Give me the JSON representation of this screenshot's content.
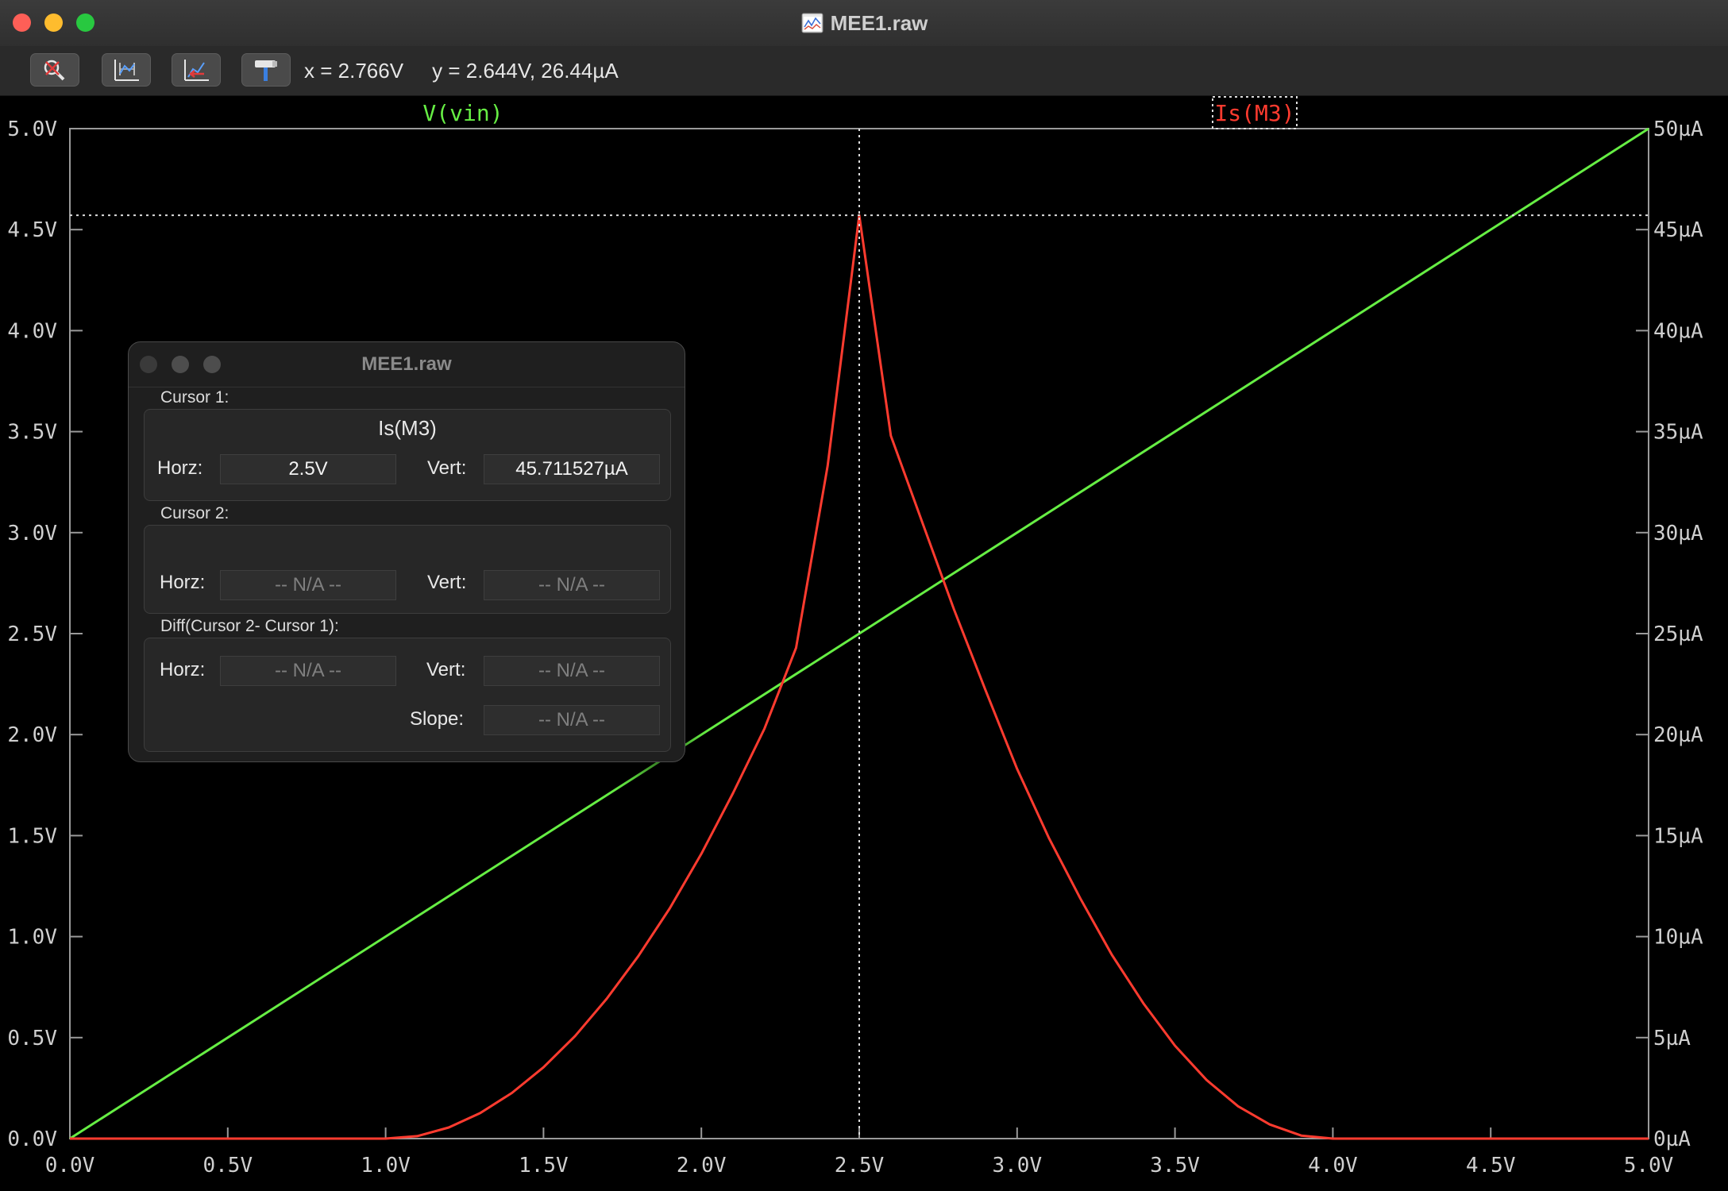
{
  "window": {
    "title": "MEE1.raw"
  },
  "toolbar": {
    "buttons": [
      {
        "name": "zoom-tool-icon"
      },
      {
        "name": "autorange-icon"
      },
      {
        "name": "zoom-back-icon"
      },
      {
        "name": "hammer-icon"
      }
    ],
    "x_readout": "x = 2.766V",
    "y_readout": "y = 2.644V, 26.44µA"
  },
  "chart_data": {
    "type": "line",
    "x_ticks": [
      "0.0V",
      "0.5V",
      "1.0V",
      "1.5V",
      "2.0V",
      "2.5V",
      "3.0V",
      "3.5V",
      "4.0V",
      "4.5V",
      "5.0V"
    ],
    "y_left_ticks": [
      "0.0V",
      "0.5V",
      "1.0V",
      "1.5V",
      "2.0V",
      "2.5V",
      "3.0V",
      "3.5V",
      "4.0V",
      "4.5V",
      "5.0V"
    ],
    "y_right_ticks": [
      "0µA",
      "5µA",
      "10µA",
      "15µA",
      "20µA",
      "25µA",
      "30µA",
      "35µA",
      "40µA",
      "45µA",
      "50µA"
    ],
    "xlim": [
      0,
      5
    ],
    "ylim_left": [
      0,
      5
    ],
    "ylim_right": [
      0,
      50
    ],
    "cursor": {
      "x": 2.5,
      "y_right": 45.711527
    },
    "series": [
      {
        "name": "V(vin)",
        "color": "#66ee44",
        "axis": "left",
        "x": [
          0,
          5
        ],
        "y": [
          0,
          5
        ]
      },
      {
        "name": "Is(M3)",
        "color": "#ff3b2f",
        "axis": "right",
        "x": [
          0,
          0.5,
          1.0,
          1.1,
          1.2,
          1.3,
          1.4,
          1.5,
          1.6,
          1.7,
          1.8,
          1.9,
          2.0,
          2.1,
          2.2,
          2.3,
          2.4,
          2.5,
          2.6,
          2.7,
          2.8,
          2.9,
          3.0,
          3.1,
          3.2,
          3.3,
          3.4,
          3.5,
          3.6,
          3.7,
          3.8,
          3.9,
          4.0,
          4.5,
          5.0
        ],
        "y": [
          0,
          0,
          0,
          0.12,
          0.55,
          1.27,
          2.26,
          3.53,
          5.08,
          6.92,
          9.03,
          11.4,
          14.1,
          17.1,
          20.3,
          24.3,
          33.3,
          45.71,
          34.8,
          30.5,
          26.2,
          22.2,
          18.3,
          14.9,
          11.9,
          9.1,
          6.7,
          4.6,
          2.9,
          1.6,
          0.7,
          0.15,
          0,
          0,
          0
        ]
      }
    ]
  },
  "cursor_panel": {
    "title": "MEE1.raw",
    "cursor1": {
      "label": "Cursor 1:",
      "trace": "Is(M3)",
      "horz_label": "Horz:",
      "horz": "2.5V",
      "vert_label": "Vert:",
      "vert": "45.711527µA"
    },
    "cursor2": {
      "label": "Cursor 2:",
      "horz_label": "Horz:",
      "horz": "-- N/A --",
      "vert_label": "Vert:",
      "vert": "-- N/A --"
    },
    "diff": {
      "label": "Diff(Cursor 2- Cursor 1):",
      "horz_label": "Horz:",
      "horz": "-- N/A --",
      "vert_label": "Vert:",
      "vert": "-- N/A --",
      "slope_label": "Slope:",
      "slope": "-- N/A --"
    }
  }
}
